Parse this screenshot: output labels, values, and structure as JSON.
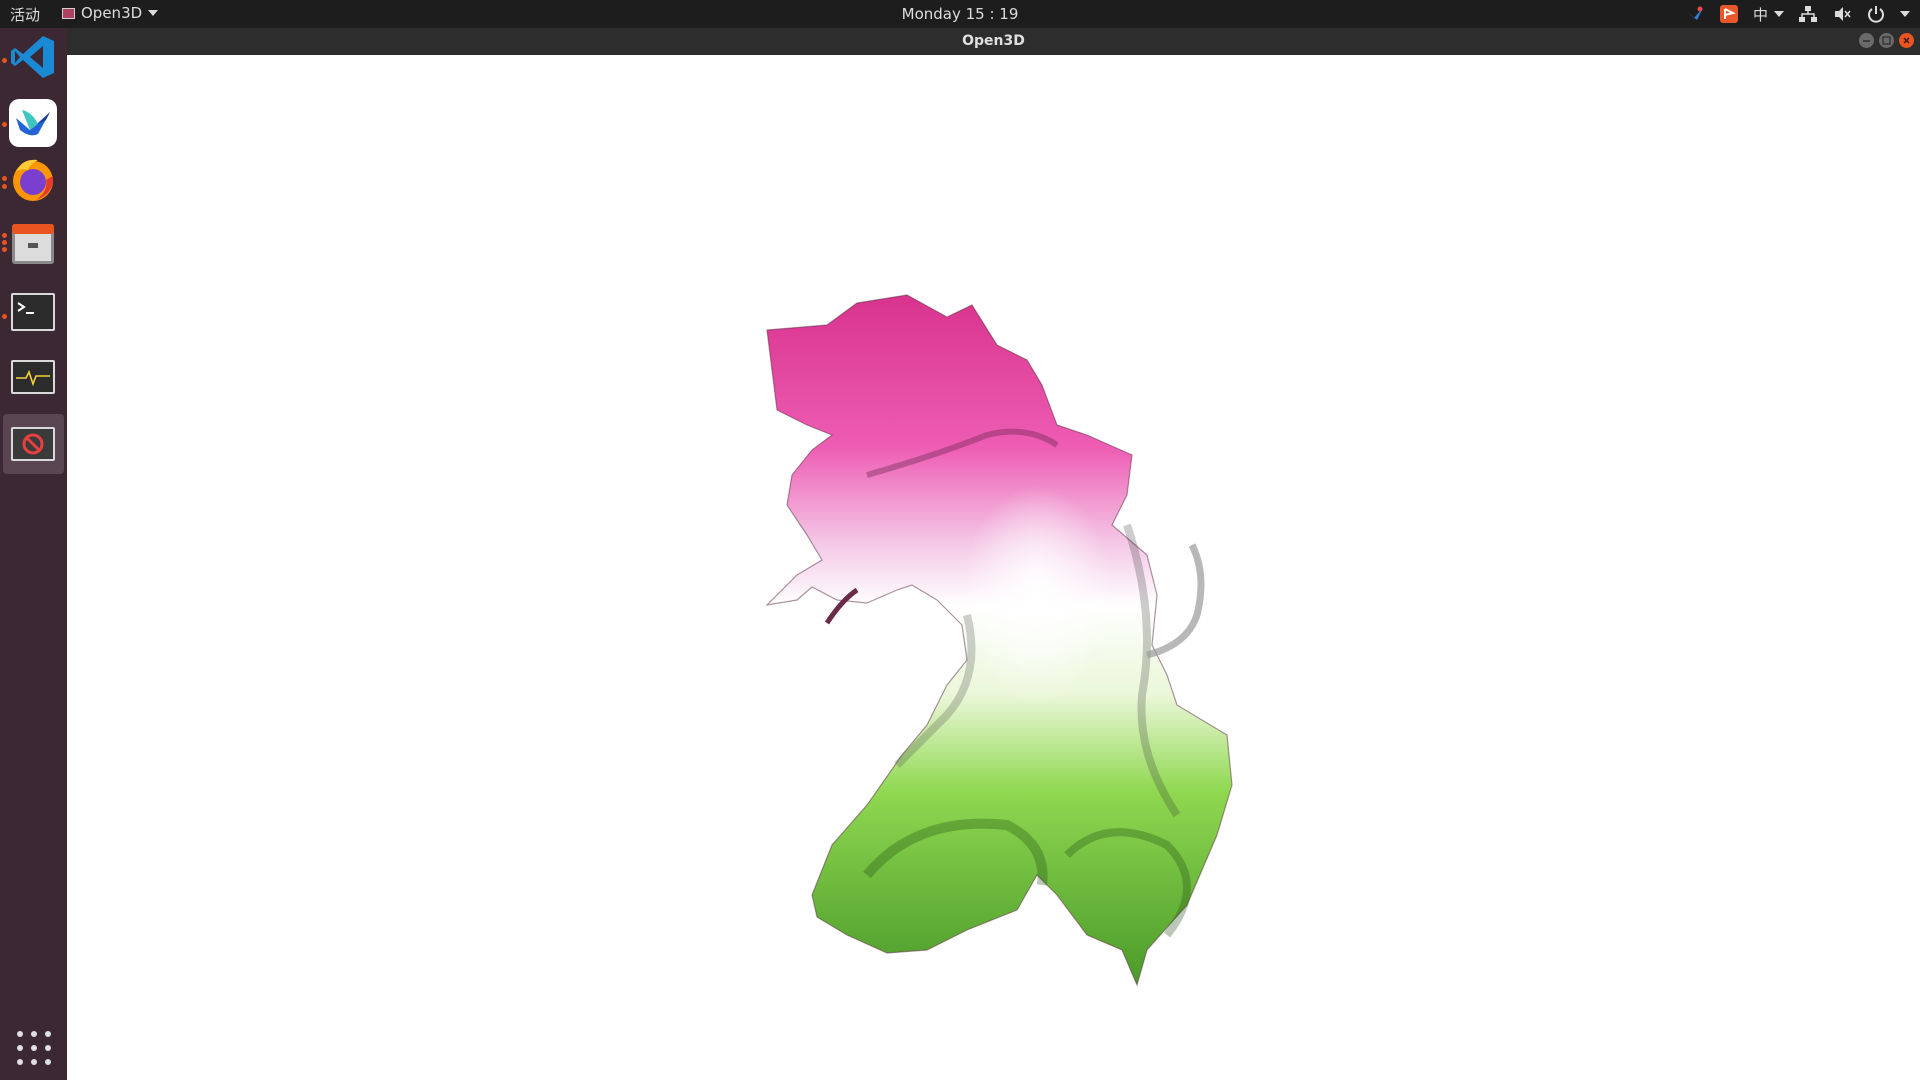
{
  "topbar": {
    "activities": "活动",
    "app_menu_label": "Open3D",
    "clock": "Monday 15 : 19",
    "ime_label": "中"
  },
  "window": {
    "title": "Open3D"
  },
  "dock": {
    "apps": [
      {
        "icon": "vscode-icon"
      },
      {
        "icon": "feishu-icon"
      },
      {
        "icon": "firefox-icon"
      },
      {
        "icon": "files-icon"
      },
      {
        "icon": "terminal-icon"
      },
      {
        "icon": "system-monitor-icon"
      },
      {
        "icon": "open3d-window-icon"
      }
    ]
  },
  "colors": {
    "mesh_top": "#e0409a",
    "mesh_bottom": "#5cb838",
    "accent": "#e95420"
  }
}
